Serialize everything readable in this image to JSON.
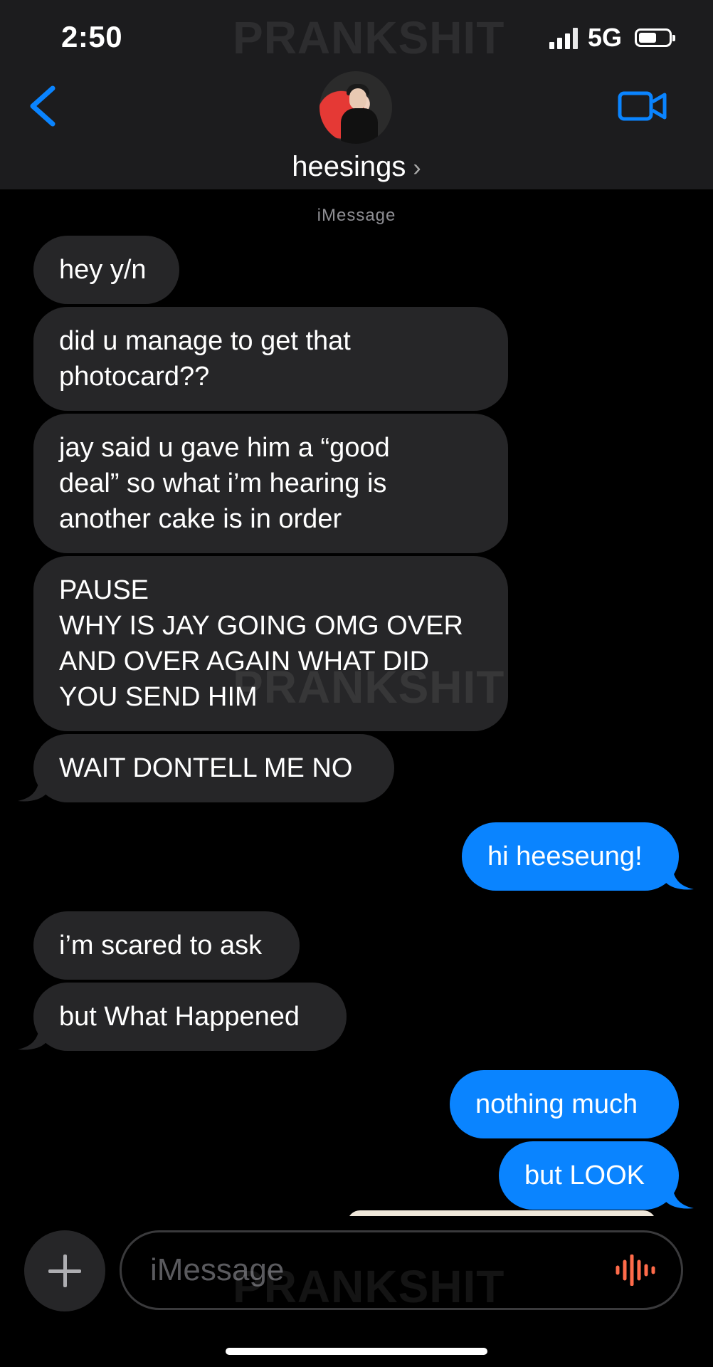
{
  "status": {
    "time": "2:50",
    "network": "5G"
  },
  "header": {
    "contact_name": "heesings",
    "chevron": "›"
  },
  "watermark": "PRANKSHIT",
  "service_label": "iMessage",
  "messages": [
    {
      "dir": "in",
      "text": "hey y/n"
    },
    {
      "dir": "in",
      "text": "did u manage to get that\nphotocard??"
    },
    {
      "dir": "in",
      "text": "jay said u gave him a “good\ndeal” so what i’m hearing is\nanother cake is in order"
    },
    {
      "dir": "in",
      "text": "PAUSE\nWHY IS JAY GOING OMG OVER\nAND OVER AGAIN WHAT DID\nYOU SEND HIM"
    },
    {
      "dir": "in",
      "text": "WAIT DONTELL ME NO"
    },
    {
      "dir": "out",
      "text": "hi heeseung!"
    },
    {
      "dir": "in",
      "text": "i’m scared to ask"
    },
    {
      "dir": "in",
      "text": "but What Happened"
    },
    {
      "dir": "out",
      "text": "nothing much"
    },
    {
      "dir": "out",
      "text": "but LOOK"
    }
  ],
  "compose": {
    "placeholder": "iMessage"
  },
  "colors": {
    "accent": "#0a84ff",
    "incoming_bubble": "#262628",
    "header_bg": "#1c1c1e",
    "mic": "#ff6b4a"
  },
  "icons": {
    "back": "chevron-left-icon",
    "video": "video-camera-icon",
    "plus": "plus-icon",
    "mic": "audio-waveform-icon"
  }
}
